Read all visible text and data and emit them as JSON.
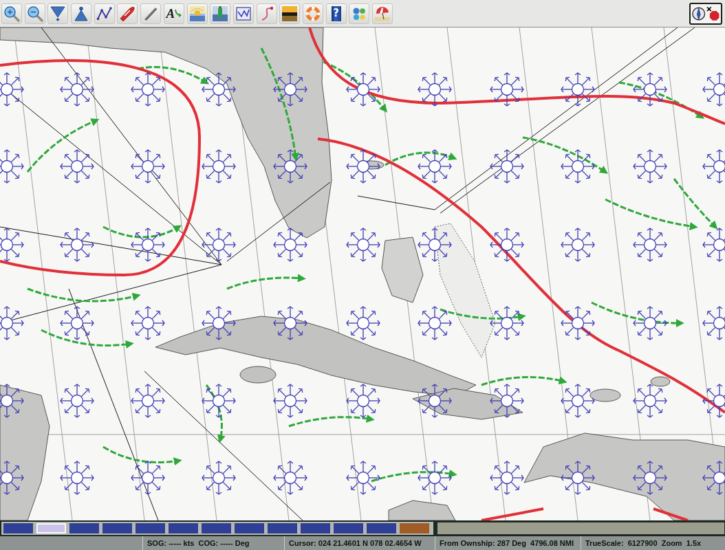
{
  "toolbar": {
    "buttons": [
      {
        "kind": "zoomin"
      },
      {
        "kind": "zoomout"
      },
      {
        "kind": "funnel"
      },
      {
        "kind": "cone"
      },
      {
        "kind": "route"
      },
      {
        "kind": "boat"
      },
      {
        "kind": "pencil"
      },
      {
        "kind": "text",
        "glyph": "A"
      },
      {
        "kind": "tide"
      },
      {
        "kind": "current"
      },
      {
        "kind": "graph"
      },
      {
        "kind": "track"
      },
      {
        "kind": "sunset"
      },
      {
        "kind": "lifebuoy"
      },
      {
        "kind": "help",
        "glyph": "?"
      },
      {
        "kind": "dots"
      },
      {
        "kind": "parasol"
      }
    ]
  },
  "piano": {
    "tiles": [
      {
        "color": "#2f3f96",
        "selected": false
      },
      {
        "color": "#c9c4e8",
        "selected": true
      },
      {
        "color": "#2f3f96",
        "selected": false
      },
      {
        "color": "#2f3f96",
        "selected": false
      },
      {
        "color": "#2f3f96",
        "selected": false
      },
      {
        "color": "#2f3f96",
        "selected": false
      },
      {
        "color": "#2f3f96",
        "selected": false
      },
      {
        "color": "#2f3f96",
        "selected": false
      },
      {
        "color": "#2f3f96",
        "selected": false
      },
      {
        "color": "#2f3f96",
        "selected": false
      },
      {
        "color": "#2f3f96",
        "selected": false
      },
      {
        "color": "#2f3f96",
        "selected": false
      },
      {
        "color": "#a15d28",
        "selected": false
      }
    ]
  },
  "status_bar": {
    "fields": [
      "SOG: ----- kts  COG: ----- Deg",
      "Cursor: 024 21.4601 N 078 02.4654 W",
      "From Ownship: 287 Deg  4796.08 NMI",
      "TrueScale:  6127900  Zoom  1.5x"
    ]
  }
}
